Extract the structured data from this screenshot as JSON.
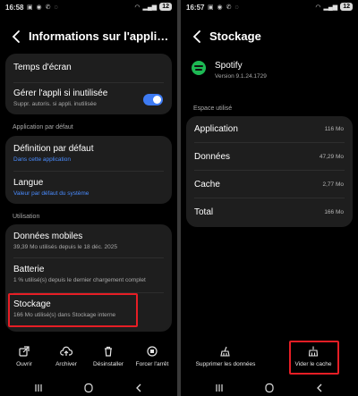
{
  "left": {
    "status": {
      "time": "16:58",
      "battery": "12"
    },
    "title": "Informations sur l'application",
    "items": {
      "screen_time": {
        "label": "Temps d'écran"
      },
      "manage_unused": {
        "label": "Gérer l'appli si inutilisée",
        "sub": "Suppr. autoris. si appli. inutilisée"
      },
      "default_section": "Application par défaut",
      "default_def": {
        "label": "Définition par défaut",
        "sub": "Dans cette application"
      },
      "language": {
        "label": "Langue",
        "sub": "Valeur par défaut du système"
      },
      "usage_section": "Utilisation",
      "mobile_data": {
        "label": "Données mobiles",
        "sub": "39,39 Mo utilisés depuis le 18 déc. 2025"
      },
      "battery": {
        "label": "Batterie",
        "sub": "1 % utilisé(s) depuis le dernier chargement complet"
      },
      "storage": {
        "label": "Stockage",
        "sub": "166 Mo utilisé(s) dans Stockage interne"
      }
    },
    "bottom": {
      "open": "Ouvrir",
      "archive": "Archiver",
      "uninstall": "Désinstaller",
      "force_stop": "Forcer l'arrêt"
    }
  },
  "right": {
    "status": {
      "time": "16:57",
      "battery": "12"
    },
    "title": "Stockage",
    "app": {
      "name": "Spotify",
      "version": "Version 9.1.24.1729"
    },
    "section": "Espace utilisé",
    "rows": [
      {
        "label": "Application",
        "value": "116 Mo"
      },
      {
        "label": "Données",
        "value": "47,29 Mo"
      },
      {
        "label": "Cache",
        "value": "2,77 Mo"
      },
      {
        "label": "Total",
        "value": "166 Mo"
      }
    ],
    "bottom": {
      "clear_data": "Supprimer les données",
      "clear_cache": "Vider le cache"
    }
  },
  "colors": {
    "accent": "#3e7bf3",
    "highlight": "#e61e25",
    "link": "#4a8cff",
    "spotify": "#1db954"
  }
}
